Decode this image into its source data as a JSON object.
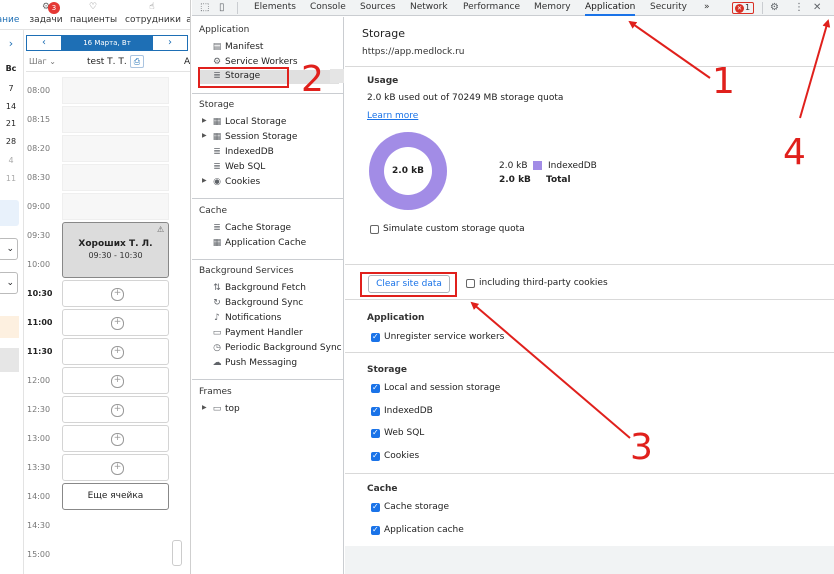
{
  "app": {
    "nav": [
      {
        "label": "ание",
        "icon": ""
      },
      {
        "label": "задачи",
        "icon": "tasks-icon",
        "badge": "3"
      },
      {
        "label": "пациенты",
        "icon": "patients-icon"
      },
      {
        "label": "сотрудники",
        "icon": "staff-icon"
      },
      {
        "label": "а",
        "icon": ""
      }
    ],
    "mini_col": {
      "header": "Вс",
      "days": [
        "7",
        "14",
        "21",
        "28",
        "4",
        "11"
      ]
    },
    "date_label": "16 Марта, Вт",
    "step_label": "Шаг",
    "doctor_label": "test Т. Т.",
    "times": [
      "08:00",
      "08:15",
      "08:20",
      "08:30",
      "09:00",
      "09:30",
      "10:00",
      "10:30",
      "11:00",
      "11:30",
      "12:00",
      "12:30",
      "13:00",
      "13:30",
      "14:00",
      "14:30",
      "15:00"
    ],
    "appointment": {
      "name": "Хороших Т. Л.",
      "time": "09:30 - 10:30"
    },
    "more_cell_label": "Еще ячейка"
  },
  "devtools": {
    "tabs": [
      "Elements",
      "Console",
      "Sources",
      "Network",
      "Performance",
      "Memory",
      "Application",
      "Security"
    ],
    "active_tab": "Application",
    "more_tabs": "»",
    "error_count": "1",
    "sidebar": {
      "application_header": "Application",
      "application_items": [
        "Manifest",
        "Service Workers",
        "Storage"
      ],
      "storage_header": "Storage",
      "storage_items": [
        "Local Storage",
        "Session Storage",
        "IndexedDB",
        "Web SQL",
        "Cookies"
      ],
      "cache_header": "Cache",
      "cache_items": [
        "Cache Storage",
        "Application Cache"
      ],
      "bg_header": "Background Services",
      "bg_items": [
        "Background Fetch",
        "Background Sync",
        "Notifications",
        "Payment Handler",
        "Periodic Background Sync",
        "Push Messaging"
      ],
      "frames_header": "Frames",
      "frames_items": [
        "top"
      ]
    },
    "main": {
      "title": "Storage",
      "origin": "https://app.medlock.ru",
      "usage_title": "Usage",
      "usage_text": "2.0 kB used out of 70249 MB storage quota",
      "learn_more": "Learn more",
      "donut_label": "2.0 kB",
      "legend": [
        {
          "value": "2.0 kB",
          "label": "IndexedDB",
          "color": "#a28ce6"
        },
        {
          "value": "2.0 kB",
          "label": "Total"
        }
      ],
      "simulate_label": "Simulate custom storage quota",
      "clear_button": "Clear site data",
      "third_party_label": "including third-party cookies",
      "application_section": "Application",
      "unregister_label": "Unregister service workers",
      "storage_section": "Storage",
      "storage_checks": [
        "Local and session storage",
        "IndexedDB",
        "Web SQL",
        "Cookies"
      ],
      "cache_section": "Cache",
      "cache_checks": [
        "Cache storage",
        "Application cache"
      ]
    }
  },
  "annotations": {
    "color": "#e0201c",
    "numbers": [
      "1",
      "2",
      "3",
      "4"
    ]
  }
}
